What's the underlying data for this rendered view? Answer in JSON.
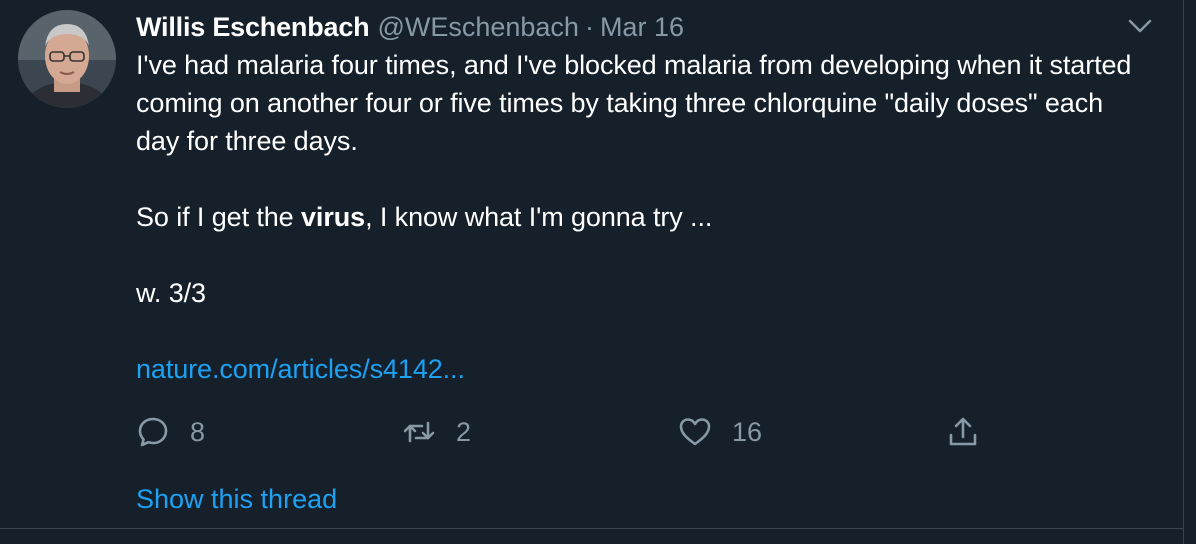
{
  "author": {
    "display_name": "Willis Eschenbach",
    "handle": "@WEschenbach",
    "separator": "·",
    "date": "Mar 16"
  },
  "tweet": {
    "para1": "I've had malaria four times, and I've blocked malaria from developing when it started coming on another four or five times by taking three chlorquine \"daily doses\" each day for three days.",
    "para2_before": "So if I get the ",
    "para2_bold": "virus",
    "para2_after": ", I know what I'm gonna try ...",
    "para3": "w. 3/3",
    "link_text": "nature.com/articles/s4142..."
  },
  "actions": {
    "reply_count": "8",
    "retweet_count": "2",
    "like_count": "16"
  },
  "thread_link": "Show this thread",
  "colors": {
    "background": "#15202b",
    "accent": "#1da1f2",
    "muted": "#8899a6",
    "text": "#ffffff"
  },
  "icons": [
    "caret-down-icon",
    "reply-icon",
    "retweet-icon",
    "like-icon",
    "share-icon"
  ]
}
